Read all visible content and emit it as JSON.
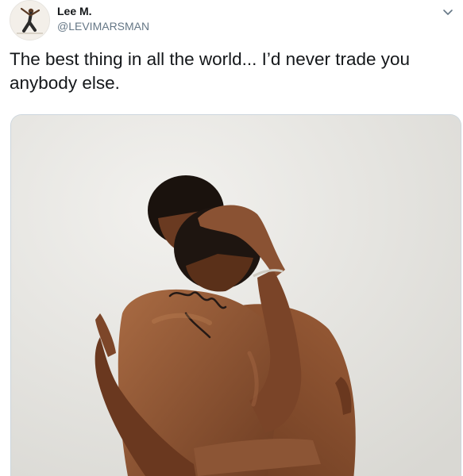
{
  "author": {
    "display_name": "Lee M.",
    "handle": "@LEVIMARSMAN",
    "avatar_icon": "avatar-yoga-pose-icon"
  },
  "menu": {
    "icon": "chevron-down-icon"
  },
  "tweet": {
    "text": "The best thing in all the world... I’d never trade you anybody else."
  },
  "media": {
    "type": "photo",
    "icon": "photo-two-men-embracing"
  },
  "colors": {
    "text_primary": "#14171a",
    "text_secondary": "#657786",
    "border": "#ccd6dd",
    "photo_background": "#e9e8e4",
    "skin": "#8a5233"
  }
}
